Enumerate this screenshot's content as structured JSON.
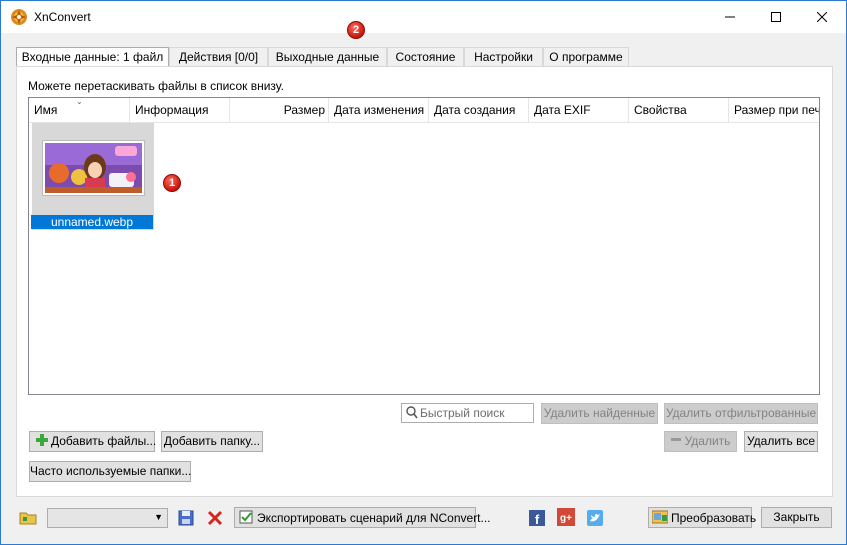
{
  "window": {
    "title": "XnConvert"
  },
  "callouts": {
    "one": "1",
    "two": "2"
  },
  "tabs": [
    {
      "label": "Входные данные: 1 файл"
    },
    {
      "label": "Действия [0/0]"
    },
    {
      "label": "Выходные данные"
    },
    {
      "label": "Состояние"
    },
    {
      "label": "Настройки"
    },
    {
      "label": "О программе"
    }
  ],
  "input": {
    "hint": "Можете перетаскивать файлы в список внизу.",
    "columns": [
      "Имя",
      "Информация",
      "Размер",
      "Дата изменения",
      "Дата создания",
      "Дата EXIF",
      "Свойства",
      "Размер при печ"
    ],
    "files": [
      {
        "name": "unnamed.webp",
        "icon": "game-screenshot-thumbnail"
      }
    ],
    "search_placeholder": "Быстрый поиск",
    "buttons": {
      "delete_found": "Удалить найденные",
      "delete_filtered": "Удалить отфильтрованные",
      "add_files": "Добавить файлы...",
      "add_folder": "Добавить папку...",
      "delete": "Удалить",
      "delete_all": "Удалить все",
      "frequent_folders": "Часто используемые папки..."
    }
  },
  "bottom": {
    "export": "Экспортировать сценарий для NConvert...",
    "convert": "Преобразовать",
    "close": "Закрыть",
    "icons": [
      "folder-icon",
      "save-icon",
      "delete-icon",
      "facebook-icon",
      "google-plus-icon",
      "twitter-icon"
    ]
  },
  "colors": {
    "accent": "#0078d7",
    "badge": "#d6190f",
    "window_border": "#2b79d0"
  }
}
